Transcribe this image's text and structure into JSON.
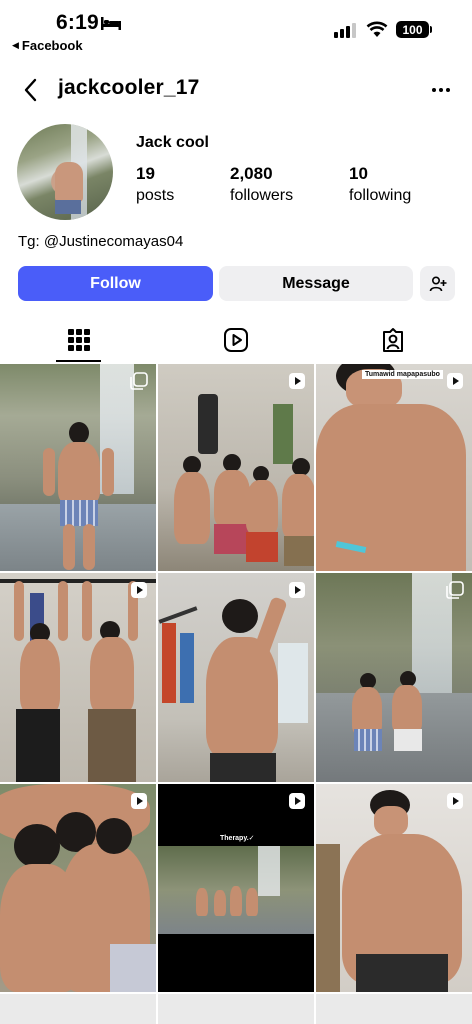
{
  "status": {
    "time": "6:19",
    "back_app": "Facebook",
    "battery": "100"
  },
  "header": {
    "username": "jackcooler_17"
  },
  "profile": {
    "display_name": "Jack cool",
    "stats": {
      "posts": {
        "value": "19",
        "label": "posts"
      },
      "followers": {
        "value": "2,080",
        "label": "followers"
      },
      "following": {
        "value": "10",
        "label": "following"
      }
    },
    "bio": "Tg: @Justinecomayas04"
  },
  "actions": {
    "follow": "Follow",
    "message": "Message"
  },
  "tabs": [
    "grid-icon",
    "reels-icon",
    "tagged-icon"
  ],
  "posts": {
    "captions": {
      "p3": "Tumawid mapapasubo",
      "p8": "Therapy.✓"
    }
  },
  "colors": {
    "accent": "#4a5df9"
  }
}
